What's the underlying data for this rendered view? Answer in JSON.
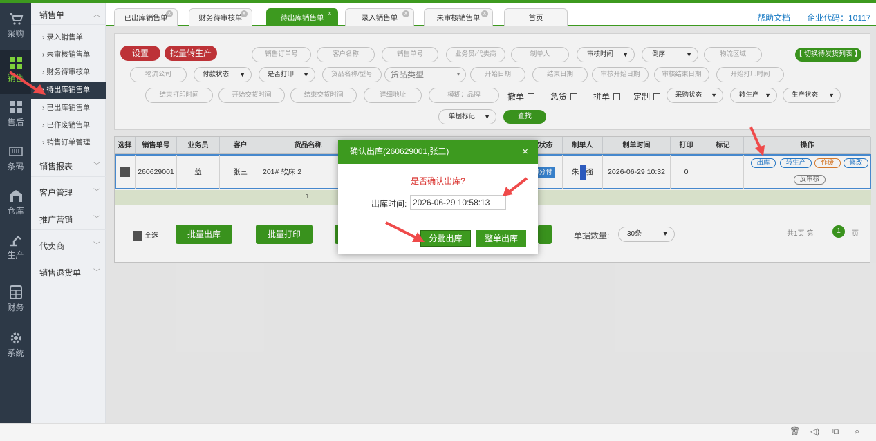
{
  "nav": {
    "items": [
      {
        "label": "采购",
        "icon": "cart-icon"
      },
      {
        "label": "销售",
        "icon": "grid-icon"
      },
      {
        "label": "售后",
        "icon": "grid-icon"
      },
      {
        "label": "条码",
        "icon": "barcode-icon"
      },
      {
        "label": "仓库",
        "icon": "warehouse-icon"
      },
      {
        "label": "生产",
        "icon": "robot-arm-icon"
      },
      {
        "label": "财务",
        "icon": "calculator-icon"
      },
      {
        "label": "系统",
        "icon": "gear-icon"
      }
    ]
  },
  "submenu": {
    "title": "销售单",
    "items": [
      "› 录入销售单",
      "› 未审核销售单",
      "› 财务待审核单",
      "› 待出库销售单",
      "› 已出库销售单",
      "› 已作废销售单",
      "› 销售订单管理"
    ],
    "groups": [
      "销售报表",
      "客户管理",
      "推广营销",
      "代卖商",
      "销售退货单"
    ]
  },
  "tabs": [
    "已出库销售单",
    "财务待审核单",
    "待出库销售单",
    "录入销售单",
    "未审核销售单",
    "首页"
  ],
  "top_links": {
    "help": "帮助文档",
    "company": "企业代码：10117"
  },
  "filters": {
    "settings_btn": "设置",
    "batch_produce_btn": "批量转生产",
    "switch_btn": "【 切换待发货列表 】",
    "search_btn": "查找",
    "row1": [
      "销售订单号",
      "客户名称",
      "销售单号",
      "业务员/代卖商",
      "制单人",
      "审核时间",
      "倒序",
      "物流区域"
    ],
    "row2": [
      "物流公司",
      "付款状态",
      "是否打印",
      "货品名称/型号",
      "货品类型",
      "开始日期",
      "结束日期",
      "审核开始日期",
      "审核结束日期",
      "开始打印时间"
    ],
    "row3": [
      "结束打印时间",
      "开始交货时间",
      "结束交货时间",
      "详细地址",
      "模糊：品牌",
      "采购状态",
      "转生产",
      "生产状态"
    ],
    "checks": [
      "撤单",
      "急货",
      "拼单",
      "定制"
    ],
    "row4": [
      "单据标记"
    ]
  },
  "table": {
    "headers": [
      "选择",
      "销售单号",
      "业务员",
      "客户",
      "货品名称",
      "款状态",
      "制单人",
      "制单时间",
      "打印",
      "标记",
      "操作"
    ],
    "row": {
      "order_no": "260629001",
      "salesman": "蓝",
      "customer": "张三",
      "product": "201# 软床 2",
      "pay_status": "部分付",
      "creator": "朱",
      "creator_tail": "强",
      "created_time": "2026-06-29 10:32",
      "print_count": "0"
    },
    "sum_qty": "1",
    "ops": [
      "出库",
      "转生产",
      "作废",
      "修改",
      "反审核"
    ]
  },
  "bottom": {
    "select_all": "全选",
    "batch_out": "批量出库",
    "batch_print": "批量打印",
    "count_label": "单据数量:",
    "count_value": "30条",
    "pager_prefix": "共1页 第",
    "page_num": "1",
    "pager_suffix": "页"
  },
  "dialog": {
    "title": "确认出库(260629001,张三)",
    "question": "是否确认出库?",
    "time_label": "出库时间:",
    "time_value": "2026-06-29 10:58:13",
    "batch_btn": "分批出库",
    "whole_btn": "整单出库"
  },
  "colors": {
    "accent": "#3d9a1f",
    "danger": "#c8353a",
    "arrow": "#ef4a4a"
  }
}
